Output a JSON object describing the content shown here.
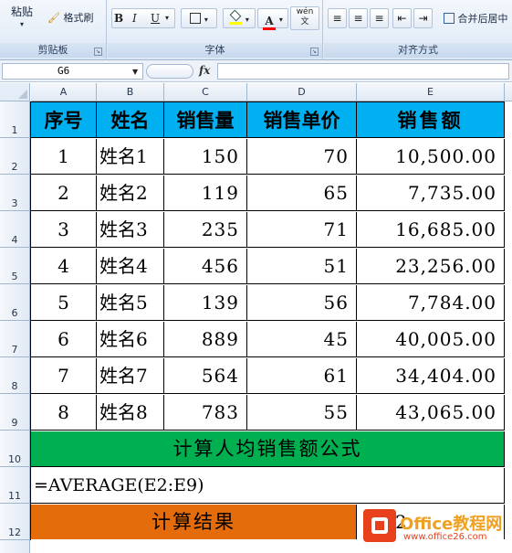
{
  "ribbon": {
    "clipboard": {
      "paste_label": "粘贴",
      "format_painter_label": "格式刷",
      "group_label": "剪贴板"
    },
    "font": {
      "bold": "B",
      "italic": "I",
      "underline": "U",
      "wen_glyph": "wén 文",
      "group_label": "字体",
      "fill_color": "#ffff00",
      "font_color": "#ff0000"
    },
    "alignment": {
      "merge_center_label": "合并后居中",
      "group_label": "对齐方式"
    }
  },
  "formula_bar": {
    "name_box": "G6",
    "fx": "fx",
    "formula": ""
  },
  "columns": [
    "A",
    "B",
    "C",
    "D",
    "E"
  ],
  "rows": [
    "1",
    "2",
    "3",
    "4",
    "5",
    "6",
    "7",
    "8",
    "9",
    "10",
    "11",
    "12"
  ],
  "table": {
    "headers": [
      "序号",
      "姓名",
      "销售量",
      "销售单价",
      "销售额"
    ],
    "data": [
      [
        "1",
        "姓名1",
        "150",
        "70",
        "10,500.00"
      ],
      [
        "2",
        "姓名2",
        "119",
        "65",
        "7,735.00"
      ],
      [
        "3",
        "姓名3",
        "235",
        "71",
        "16,685.00"
      ],
      [
        "4",
        "姓名4",
        "456",
        "51",
        "23,256.00"
      ],
      [
        "5",
        "姓名5",
        "139",
        "56",
        "7,784.00"
      ],
      [
        "6",
        "姓名6",
        "889",
        "45",
        "40,005.00"
      ],
      [
        "7",
        "姓名7",
        "564",
        "61",
        "34,404.00"
      ],
      [
        "8",
        "姓名8",
        "783",
        "55",
        "43,065.00"
      ]
    ]
  },
  "formula_title": "计算人均销售额公式",
  "formula_text": "=AVERAGE(E2:E9)",
  "result_label": "计算结果",
  "result_value": "2",
  "colors": {
    "header_blue": "#00b0f0",
    "green": "#00b050",
    "orange": "#e46c0a"
  },
  "watermark": {
    "title": "Office教程网",
    "url": "www.office26.com"
  }
}
